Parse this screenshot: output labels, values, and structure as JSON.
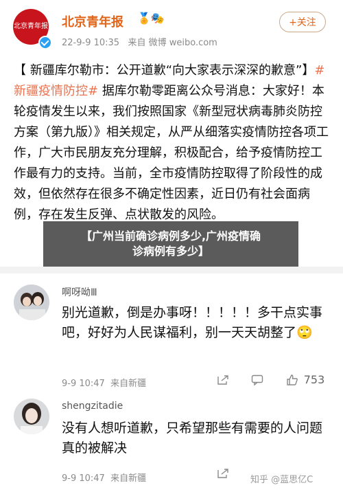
{
  "post": {
    "author": "北京青年报",
    "author_emojis": "🏅🎭",
    "avatar_text": "北京青年报",
    "timestamp": "22-9-9 10:35",
    "source": "来自 微博 weibo.com",
    "follow_label": "+关注",
    "body_prefix": "【 新疆库尔勒市：公开道歉“向大家表示深深的歉意”】",
    "hashtag": "#新疆疫情防控#",
    "body_rest": " 据库尔勒零距离公众号消息：大家好！本轮疫情发生以来，我们按照国家《新型冠状病毒肺炎防控方案（第九版）》相关规定，从严从细落实疫情防控各项工作，广大市民朋友充分理解，积极配合，给予疫情防控工作最有力的支持。当前，全市疫情防控取得了阶段性的成效，但依然存在很多不确定性因素，近日仍有社会面病例，存在发生反弹、点状散发的风险。"
  },
  "overlay": {
    "line1": "【广州当前确诊病例多少,广州疫情确",
    "line2": "诊病例有多少】"
  },
  "comments": [
    {
      "user": "啊呀呦Ⅲ",
      "text": "别光道歉，倒是办事呀！！！！！多干点实事吧，好好为人民谋福利，别一天天胡整了🙄",
      "time": "9-9 10:47",
      "location": "来自新疆",
      "likes": "753"
    },
    {
      "user": "shengzitadie",
      "text": "没有人想听道歉，只希望那些有需要的人问题真的被解决",
      "time": "9-9 10:47",
      "location": "来自新疆",
      "likes": ""
    }
  ],
  "watermark": "知乎 @蓝思亿C"
}
